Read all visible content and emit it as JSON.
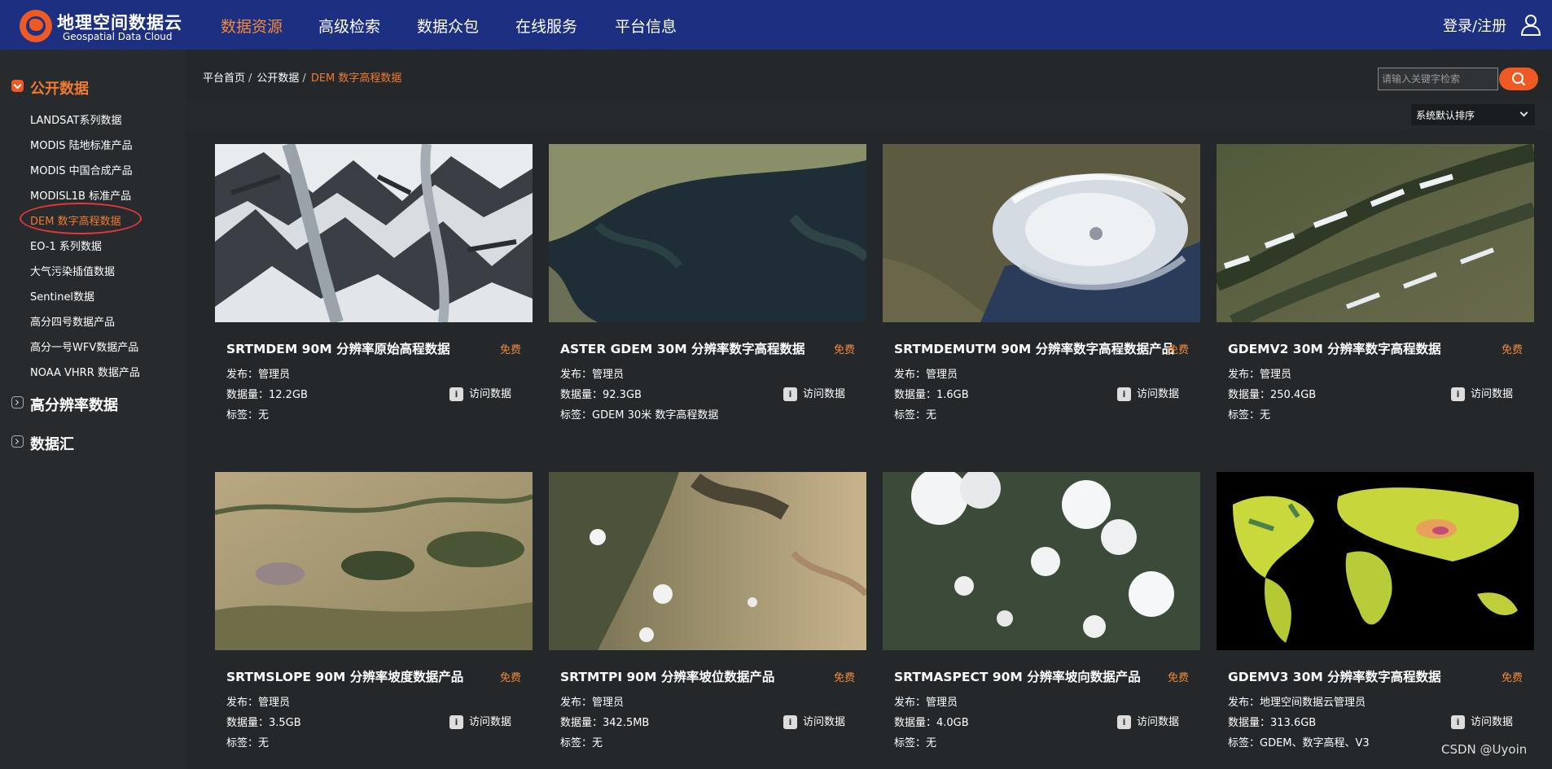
{
  "brand": {
    "name_cn": "地理空间数据云",
    "name_en": "Geospatial Data Cloud"
  },
  "nav": {
    "items": [
      {
        "label": "数据资源",
        "active": true
      },
      {
        "label": "高级检索"
      },
      {
        "label": "数据众包"
      },
      {
        "label": "在线服务"
      },
      {
        "label": "平台信息"
      }
    ],
    "login": "登录/注册"
  },
  "sidebar": {
    "categories": [
      {
        "label": "公开数据",
        "state": "open"
      },
      {
        "label": "高分辨率数据",
        "state": "closed"
      },
      {
        "label": "数据汇",
        "state": "closed"
      }
    ],
    "items": [
      {
        "label": "LANDSAT系列数据"
      },
      {
        "label": "MODIS 陆地标准产品"
      },
      {
        "label": "MODIS 中国合成产品"
      },
      {
        "label": "MODISL1B 标准产品"
      },
      {
        "label": "DEM 数字高程数据",
        "active": true
      },
      {
        "label": "EO-1 系列数据"
      },
      {
        "label": "大气污染插值数据"
      },
      {
        "label": "Sentinel数据"
      },
      {
        "label": "高分四号数据产品"
      },
      {
        "label": "高分一号WFV数据产品"
      },
      {
        "label": "NOAA VHRR 数据产品"
      }
    ]
  },
  "breadcrumb": {
    "home": "平台首页",
    "sep": "/",
    "section": "公开数据",
    "current": "DEM 数字高程数据"
  },
  "search": {
    "placeholder": "请输入关键字检索"
  },
  "sort": {
    "selected": "系统默认排序"
  },
  "cards": [
    {
      "title": "SRTMDEM 90M 分辨率原始高程数据",
      "price": "免费",
      "publisher": "发布：管理员",
      "size": "数据量：12.2GB",
      "tags": "标签：无",
      "visit": "访问数据",
      "thumb": "snow-mountains"
    },
    {
      "title": "ASTER GDEM 30M 分辨率数字高程数据",
      "price": "免费",
      "publisher": "发布：管理员",
      "size": "数据量：92.3GB",
      "tags": "标签：GDEM 30米 数字高程数据",
      "visit": "访问数据",
      "thumb": "coastline"
    },
    {
      "title": "SRTMDEMUTM 90M 分辨率数字高程数据产品",
      "price": "免费",
      "publisher": "发布：管理员",
      "size": "数据量：1.6GB",
      "tags": "标签：无",
      "visit": "访问数据",
      "thumb": "typhoon"
    },
    {
      "title": "GDEMV2 30M 分辨率数字高程数据",
      "price": "免费",
      "publisher": "发布：管理员",
      "size": "数据量：250.4GB",
      "tags": "标签：无",
      "visit": "访问数据",
      "thumb": "ridges-clouds"
    },
    {
      "title": "SRTMSLOPE 90M 分辨率坡度数据产品",
      "price": "免费",
      "publisher": "发布：管理员",
      "size": "数据量：3.5GB",
      "tags": "标签：无",
      "visit": "访问数据",
      "thumb": "plains"
    },
    {
      "title": "SRTMTPI 90M 分辨率坡位数据产品",
      "price": "免费",
      "publisher": "发布：管理员",
      "size": "数据量：342.5MB",
      "tags": "标签：无",
      "visit": "访问数据",
      "thumb": "arid-terrain"
    },
    {
      "title": "SRTMASPECT 90M 分辨率坡向数据产品",
      "price": "免费",
      "publisher": "发布：管理员",
      "size": "数据量：4.0GB",
      "tags": "标签：无",
      "visit": "访问数据",
      "thumb": "cumulus"
    },
    {
      "title": "GDEMV3 30M 分辨率数字高程数据",
      "price": "免费",
      "publisher": "发布：地理空间数据云管理员",
      "size": "数据量：313.6GB",
      "tags": "标签：GDEM、数字高程、V3",
      "visit": "访问数据",
      "thumb": "world-elevation"
    }
  ],
  "watermark": "CSDN @Uyoin",
  "colors": {
    "nav_bg": "#1d2f80",
    "accent": "#ef7a32",
    "page_bg": "#24282b",
    "sidebar_bg": "#272b2e"
  }
}
